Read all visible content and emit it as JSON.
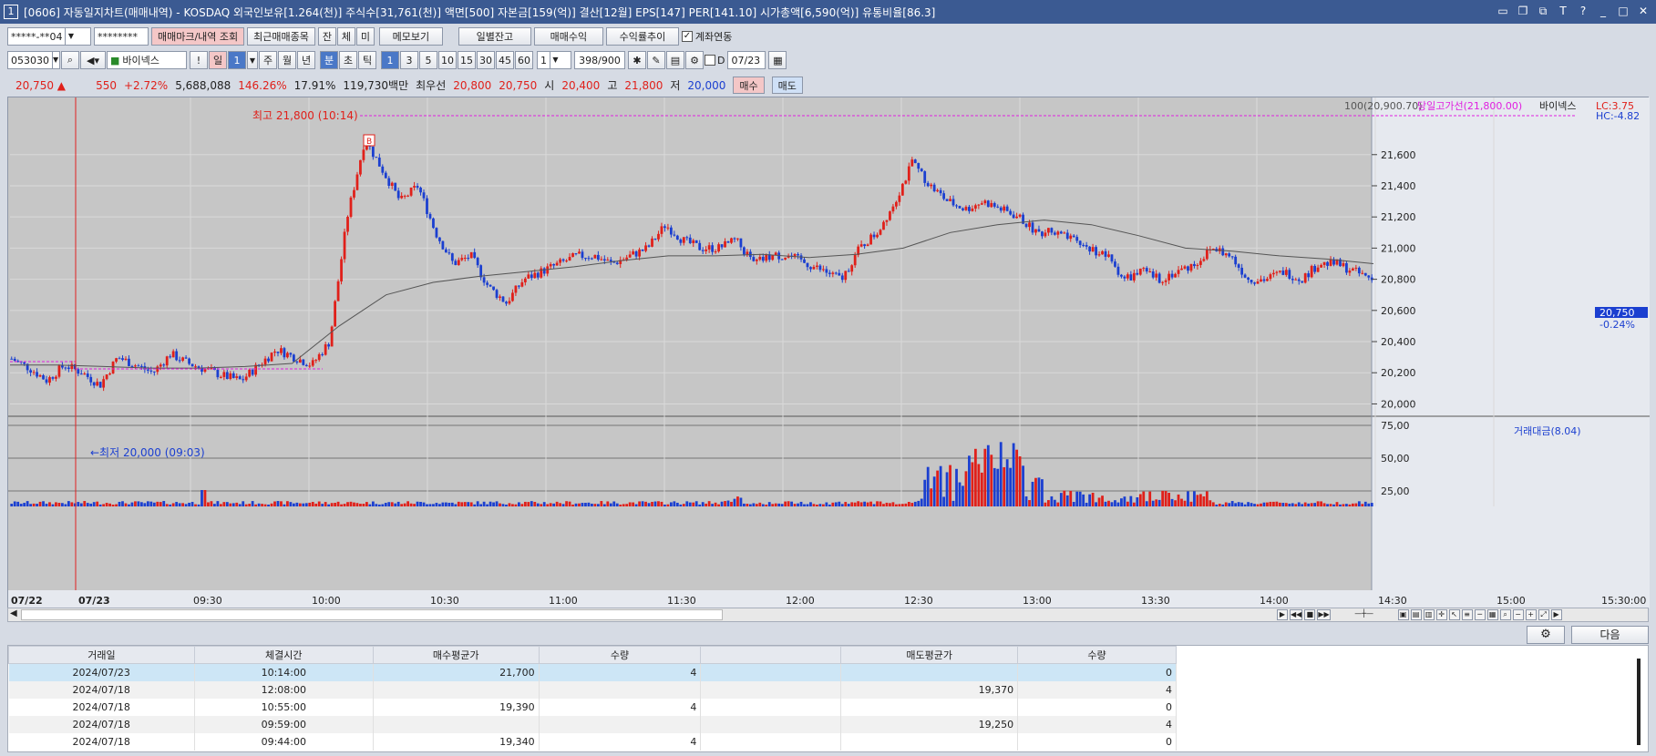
{
  "window": {
    "number": "1",
    "title": "[0606] 자동일지차트(매매내역) - KOSDAQ 외국인보유[1.264(천)] 주식수[31,761(천)] 액면[500] 자본금[159(억)] 결산[12월] EPS[147] PER[141.10] 시가총액[6,590(억)] 유통비율[86.3]"
  },
  "toolbar1": {
    "account": "*****-**04",
    "password": "********",
    "mark_btn": "매매마크/내역 조회",
    "recent_btn": "최근매매종목",
    "jan": "잔",
    "che": "체",
    "mi": "미",
    "memo_btn": "메모보기",
    "daily_btn": "일별잔고",
    "profit_btn": "매매수익",
    "return_btn": "수익률추이",
    "link_label": "계좌연동"
  },
  "toolbar2": {
    "code": "053030",
    "name": "바이넥스",
    "period_day": "일",
    "period_day_n": "1",
    "week": "주",
    "month": "월",
    "year": "년",
    "min": "분",
    "sec": "초",
    "tick": "틱",
    "intervals": [
      "1",
      "3",
      "5",
      "10",
      "15",
      "30",
      "45",
      "60"
    ],
    "interval_sel": "1",
    "count": "398/900",
    "d_label": "D",
    "date": "07/23"
  },
  "quote": {
    "price": "20,750 ▲",
    "change": "550",
    "change_pct": "+2.72%",
    "volume": "5,688,088",
    "vol_ratio": "146.26%",
    "turnover": "17.91%",
    "amount": "119,730백만",
    "best_label": "최우선",
    "ask": "20,800",
    "bid": "20,750",
    "open_label": "시",
    "open": "20,400",
    "high_label": "고",
    "high": "21,800",
    "low_label": "저",
    "low": "20,000",
    "buy_btn": "매수",
    "sell_btn": "매도"
  },
  "chart_data": {
    "type": "candlestick",
    "title": "",
    "price_axis": {
      "ticks": [
        "21,600",
        "21,400",
        "21,200",
        "21,000",
        "20,800",
        "20,600",
        "20,400",
        "20,200",
        "20,000"
      ],
      "range": [
        19950,
        21850
      ]
    },
    "volume_axis": {
      "ticks": [
        "75,00",
        "50,00",
        "25,00"
      ]
    },
    "time_ticks": [
      "07/22",
      "07/23",
      "09:30",
      "10:00",
      "10:30",
      "11:00",
      "11:30",
      "12:00",
      "12:30",
      "13:00",
      "13:30",
      "14:00",
      "14:30",
      "15:00",
      "15:30:00"
    ],
    "legend": {
      "ma": "100(20,900.70)",
      "high_line": "당일고가선(21,800.00)",
      "name": "바이넥스"
    },
    "volume_legend": "거래대금(8.04)",
    "lc_hc": [
      "LC:3.75",
      "HC:-4.82"
    ],
    "current_price": "20,750",
    "current_pct": "-0.24%",
    "annotations": {
      "high": "최고 21,800 (10:14)",
      "low": "←최저 20,000 (09:03)",
      "buy_mark": "B"
    },
    "price_path": [
      20290,
      20230,
      20150,
      20250,
      20200,
      20120,
      20300,
      20250,
      20200,
      20320,
      20260,
      20220,
      20180,
      20150,
      20250,
      20350,
      20300,
      20250,
      20400,
      21200,
      21700,
      21500,
      21300,
      21400,
      21100,
      20900,
      20950,
      20750,
      20650,
      20800,
      20850,
      20900,
      20950,
      20950,
      20900,
      20950,
      21000,
      21150,
      21050,
      21000,
      21000,
      21050,
      20900,
      20950,
      20950,
      20900,
      20850,
      20800,
      21000,
      21100,
      21300,
      21550,
      21400,
      21300,
      21250,
      21300,
      21250,
      21200,
      21100,
      21100,
      21050,
      21000,
      20950,
      20800,
      20850,
      20800,
      20850,
      20900,
      21000,
      20950,
      20800,
      20800,
      20850,
      20800,
      20900,
      20900,
      20850,
      20800
    ],
    "ma_path": [
      20250,
      20250,
      20240,
      20230,
      20230,
      20240,
      20260,
      20500,
      20700,
      20780,
      20820,
      20850,
      20880,
      20920,
      20950,
      20950,
      20960,
      20940,
      20960,
      21000,
      21100,
      21150,
      21180,
      21150,
      21080,
      21000,
      20980,
      20950,
      20930,
      20900
    ]
  },
  "table": {
    "headers": [
      "거래일",
      "체결시간",
      "매수평균가",
      "수량",
      "",
      "매도평균가",
      "수량"
    ],
    "rows": [
      [
        "2024/07/23",
        "10:14:00",
        "21,700",
        "4",
        "",
        "",
        "0"
      ],
      [
        "2024/07/18",
        "12:08:00",
        "",
        "",
        "",
        "19,370",
        "4"
      ],
      [
        "2024/07/18",
        "10:55:00",
        "19,390",
        "4",
        "",
        "",
        "0"
      ],
      [
        "2024/07/18",
        "09:59:00",
        "",
        "",
        "",
        "19,250",
        "4"
      ],
      [
        "2024/07/18",
        "09:44:00",
        "19,340",
        "4",
        "",
        "",
        "0"
      ]
    ]
  },
  "footer": {
    "next_btn": "다음"
  },
  "colors": {
    "up": "#e0201a",
    "down": "#1b3fd0",
    "title_bar": "#3b5a92",
    "chart_bg": "#c6c6c6",
    "ma": "#555555",
    "high_line": "#e020e0"
  }
}
